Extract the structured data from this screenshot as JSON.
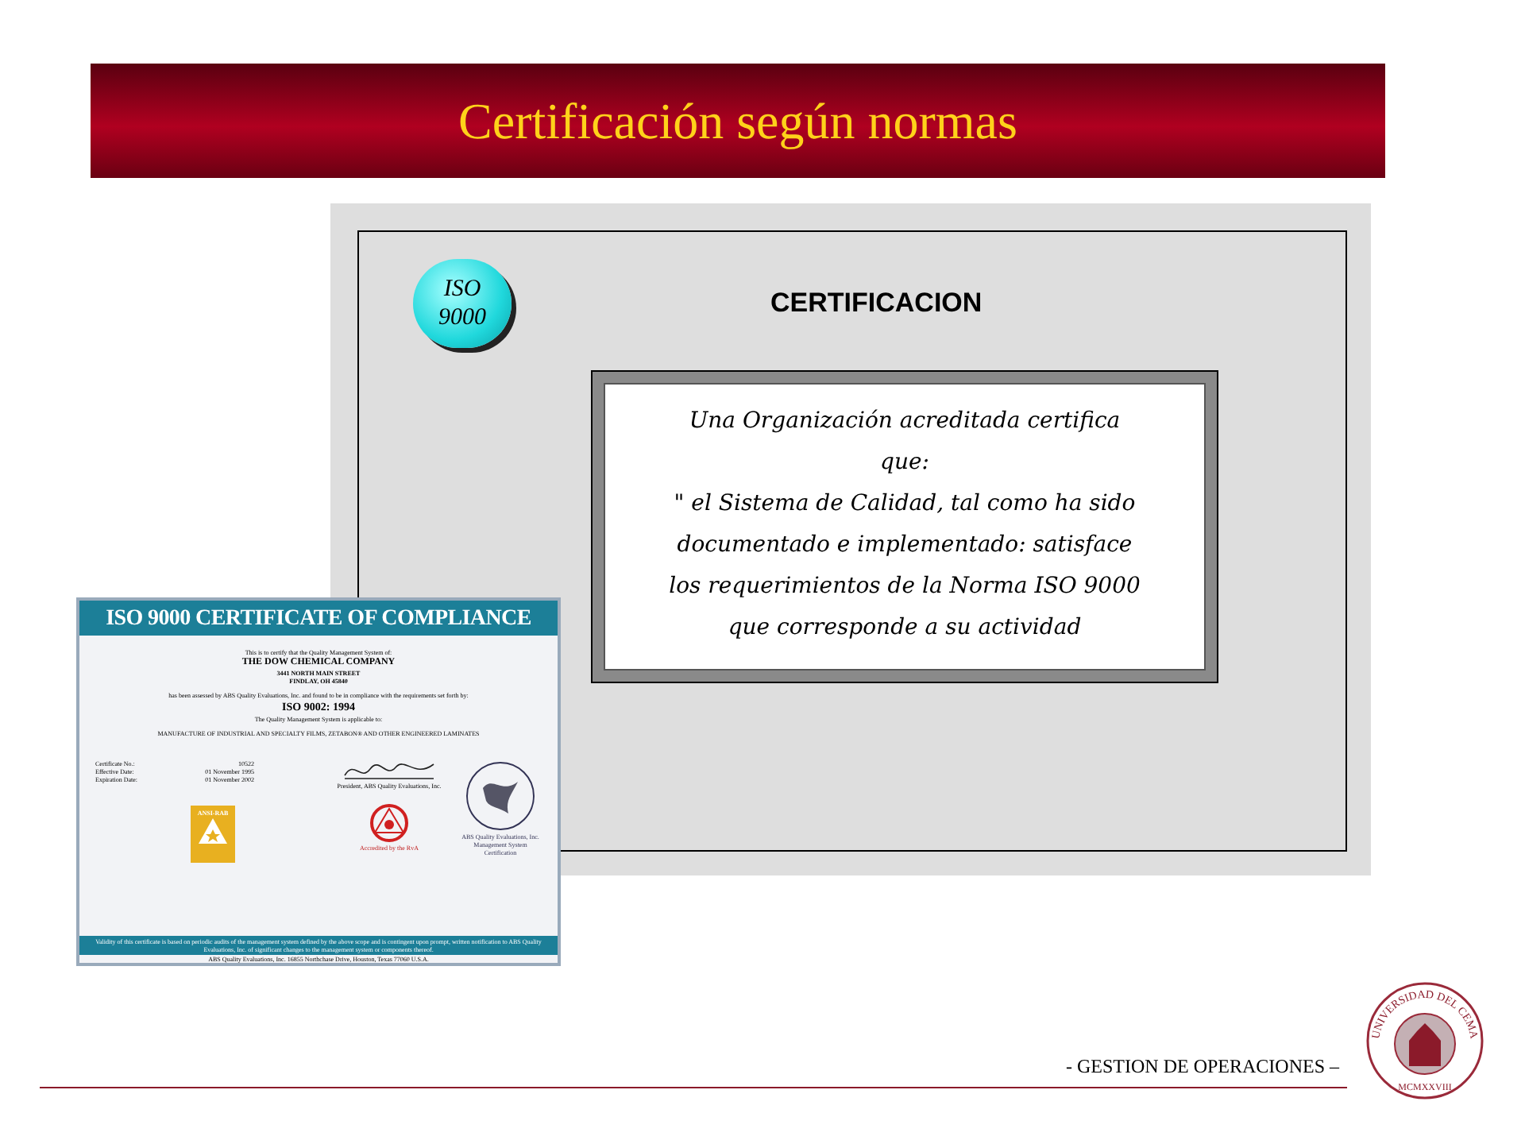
{
  "title": "Certificación  según normas",
  "panel": {
    "badge": [
      "ISO",
      "9000"
    ],
    "heading": "CERTIFICACION",
    "quote_lines": [
      "Una Organización acreditada certifica",
      "que:",
      "\" el Sistema de Calidad, tal como ha sido",
      "documentado e implementado: satisface",
      "los requerimientos de la Norma ISO 9000",
      "que corresponde a su actividad"
    ]
  },
  "certificate": {
    "header": "ISO 9000 CERTIFICATE OF COMPLIANCE",
    "intro": "This is to certify that the Quality Management System of:",
    "company": "THE DOW CHEMICAL COMPANY",
    "address": [
      "3441 NORTH MAIN STREET",
      "FINDLAY, OH  45840"
    ],
    "assessed": "has been assessed by ABS Quality Evaluations, Inc. and found to be in compliance with the requirements set forth by:",
    "standard": "ISO 9002: 1994",
    "applicable": "The Quality Management System is applicable to:",
    "scope": "MANUFACTURE OF INDUSTRIAL AND SPECIALTY FILMS, ZETABON® AND OTHER ENGINEERED LAMINATES",
    "details": [
      {
        "label": "Certificate No.:",
        "value": "10522"
      },
      {
        "label": "Effective Date:",
        "value": "01 November 1995"
      },
      {
        "label": "Expiration Date:",
        "value": "01 November 2002"
      }
    ],
    "signer": "President, ABS Quality Evaluations, Inc.",
    "mark_label": "ANSI-RAB",
    "accredited": "Accredited by the RvA",
    "seal_text": "ABS Quality Evaluations, Inc. Management System Certification",
    "validity": "Validity of this certificate is based on periodic audits of the management system defined by the above scope and is contingent upon prompt, written notification to ABS Quality Evaluations, Inc. of significant changes to the management system or components thereof.",
    "footer": "ABS Quality Evaluations, Inc. 16855 Northchase Drive, Houston, Texas 77060 U.S.A."
  },
  "footer": {
    "text": "- GESTION DE OPERACIONES  –",
    "seal_top": "UNIVERSIDAD DEL CEMA",
    "seal_bottom": "MCMXXVIII"
  }
}
